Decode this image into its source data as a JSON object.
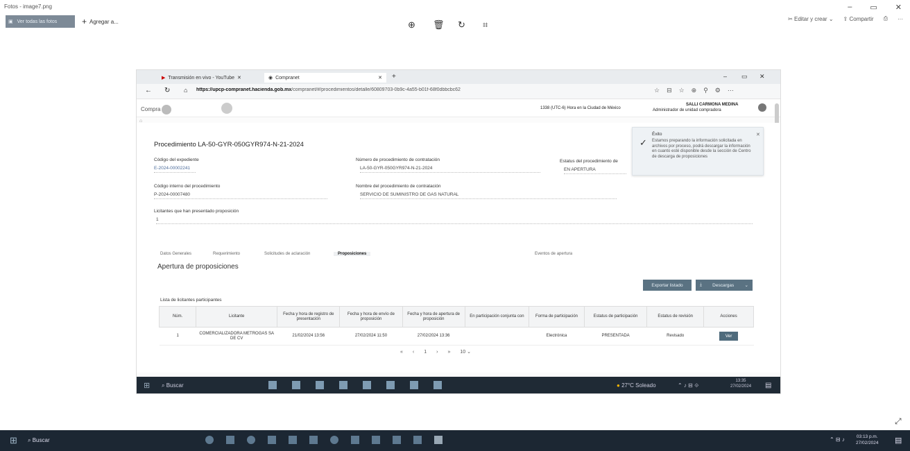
{
  "viewer": {
    "title": "Fotos - image7.png",
    "see_all": "Ver todas las fotos",
    "add_to": "Agregar a...",
    "edit_create": "Editar y crear",
    "share": "Compartir"
  },
  "browser": {
    "tab1": "Transmisión en vivo - YouTube",
    "tab2": "Compranet",
    "url_host": "https://upcp-compranet.hacienda.gob.mx",
    "url_rest": "/compranet/#/procedimientos/detalle/60809703-0b9c-4a55-b01f-68f0dbbcbc62"
  },
  "site": {
    "logo": "Compra",
    "timezone": "1338 (UTC-6) Hora en la Ciudad de México",
    "user_name": "SALLI CARMONA MEDINA",
    "user_role": "Administrador de unidad compradora"
  },
  "procedure": {
    "title": "Procedimiento LA-50-GYR-050GYR974-N-21-2024",
    "exp_label": "Código del expediente",
    "exp_value": "E-2024-00002241",
    "num_label": "Número de procedimiento de contratación",
    "num_value": "LA-50-GYR-050GYR974-N-21-2024",
    "status_label": "Estatus del procedimiento de",
    "status_value": "EN APERTURA",
    "internal_label": "Código interno del procedimiento",
    "internal_value": "P-2024-00007480",
    "name_label": "Nombre del procedimiento de contratación",
    "name_value": "SERVICIO DE SUMINISTRO DE GAS NATURAL",
    "bidders_label": "Licitantes que han presentado proposición",
    "bidders_value": "1"
  },
  "toast": {
    "title": "Éxito",
    "body": "Estamos preparando la información solicitada en archivos por proceso, podrá descargar la información en cuanto esté disponible desde la sección de Centro de descarga de proposiciones"
  },
  "subtabs": [
    "Datos Generales",
    "Requerimiento",
    "Solicitudes de aclaración",
    "Proposiciones",
    "Eventos de apertura"
  ],
  "section_title": "Apertura de proposiciones",
  "buttons": {
    "export": "Exportar listado",
    "download": "Descargas"
  },
  "list_label": "Lista de licitantes participantes",
  "table": {
    "headers": [
      "Núm.",
      "Licitante",
      "Fecha y hora de registro de presentación",
      "Fecha y hora de envío de proposición",
      "Fecha y hora de apertura de proposición",
      "En participación conjunta con",
      "Forma de participación",
      "Estatus de participación",
      "Estatus de revisión",
      "Acciones"
    ],
    "rows": [
      [
        "1",
        "COMERCIALIZADORA METROGAS SA DE CV",
        "21/02/2024 13:56",
        "27/02/2024 11:50",
        "27/02/2024 13:36",
        "",
        "Electrónica",
        "PRESENTADA",
        "Revisado",
        "Ver"
      ]
    ]
  },
  "pager": {
    "page": "1",
    "per_page": "10"
  },
  "inner_taskbar": {
    "search": "Buscar",
    "weather": "27°C Soleado",
    "time": "13:35",
    "date": "27/02/2024"
  },
  "taskbar": {
    "search": "Buscar",
    "time": "03:13 p.m.",
    "date": "27/02/2024"
  }
}
